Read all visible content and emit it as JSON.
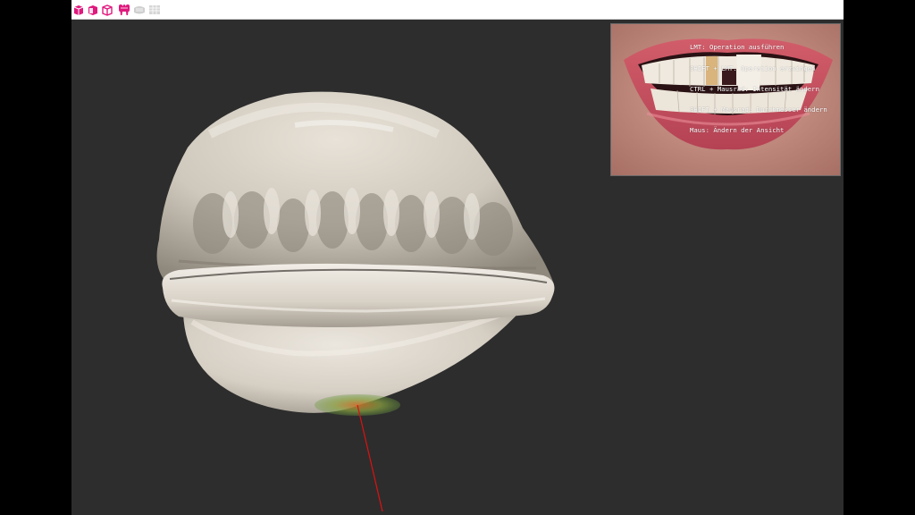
{
  "toolbar": {
    "buttons": [
      {
        "icon": "cube-front-icon",
        "active": true
      },
      {
        "icon": "cube-side-icon",
        "active": true
      },
      {
        "icon": "cube-wireframe-icon",
        "active": true
      },
      {
        "icon": "tooth-icon",
        "active": true
      },
      {
        "icon": "jaw-scan-icon",
        "active": false
      },
      {
        "icon": "grid-panel-icon",
        "active": false
      }
    ],
    "active_color": "#e0197d",
    "inactive_color": "#c8c8c8"
  },
  "help_text": {
    "line1": "LMT: Operation ausführen",
    "line2": "SHIFT + LMT: Operation erzwingen",
    "line3": "CTRL + Mausrad: Intensität ändern",
    "line4": "SHIFT + Mausrad: Durchmesser ändern",
    "line5": "Maus: Ändern der Ansicht"
  },
  "colors": {
    "background": "#2d2d2d",
    "model": "#cdc6ba",
    "cursor_line": "#e01010",
    "brush": "#7a9a40"
  }
}
